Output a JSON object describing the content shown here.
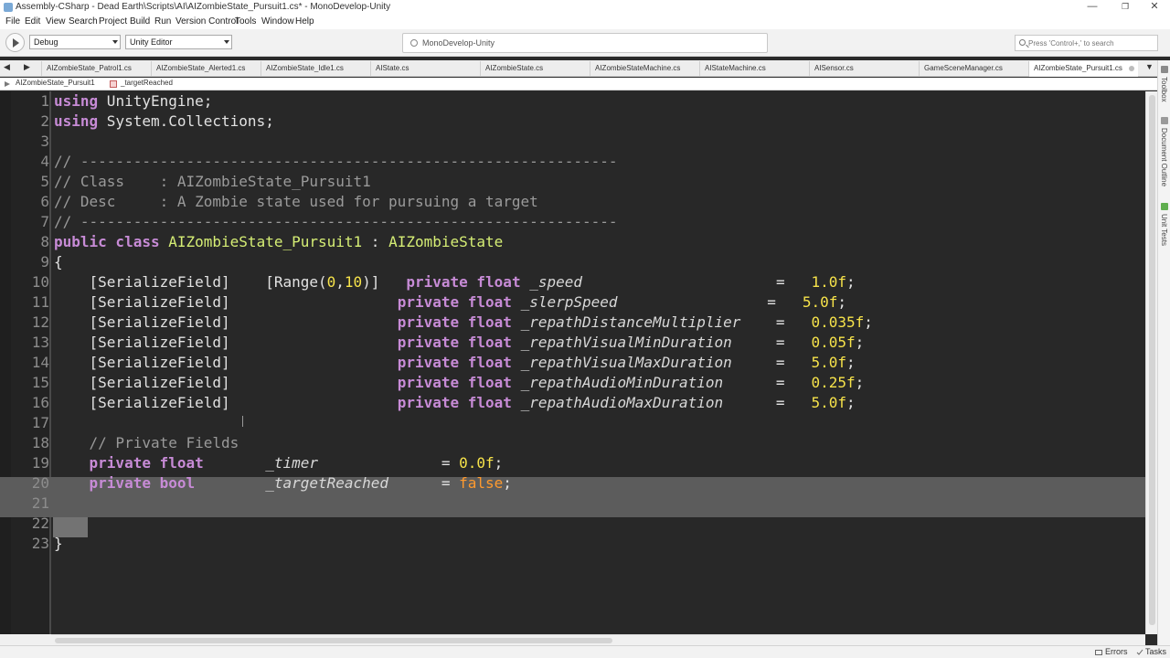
{
  "window": {
    "title": "Assembly-CSharp - Dead Earth\\Scripts\\AI\\AIZombieState_Pursuit1.cs* - MonoDevelop-Unity",
    "minimize": "—",
    "maximize": "❐",
    "close": "✕"
  },
  "menu": [
    "File",
    "Edit",
    "View",
    "Search",
    "Project",
    "Build",
    "Run",
    "Version Control",
    "Tools",
    "Window",
    "Help"
  ],
  "toolbar": {
    "configuration": "Debug",
    "target": "Unity Editor",
    "status": "MonoDevelop-Unity",
    "search_placeholder": "Press 'Control+,' to search"
  },
  "tabs": [
    {
      "label": "AIZombieState_Patrol1.cs"
    },
    {
      "label": "AIZombieState_Alerted1.cs"
    },
    {
      "label": "AIZombieState_Idle1.cs"
    },
    {
      "label": "AIState.cs"
    },
    {
      "label": "AIZombieState.cs"
    },
    {
      "label": "AIZombieStateMachine.cs"
    },
    {
      "label": "AIStateMachine.cs"
    },
    {
      "label": "AISensor.cs"
    },
    {
      "label": "GameSceneManager.cs"
    },
    {
      "label": "AIZombieState_Pursuit1.cs",
      "active": true
    }
  ],
  "breadcrumb": {
    "class_name": "AIZombieState_Pursuit1",
    "member": "_targetReached"
  },
  "editor": {
    "lines": [
      {
        "n": "1",
        "segs": [
          [
            "kw",
            "using"
          ],
          [
            "txt",
            " UnityEngine;"
          ]
        ]
      },
      {
        "n": "2",
        "segs": [
          [
            "kw",
            "using"
          ],
          [
            "txt",
            " System.Collections;"
          ]
        ]
      },
      {
        "n": "3",
        "segs": []
      },
      {
        "n": "4",
        "segs": [
          [
            "cm",
            "// -------------------------------------------------------------"
          ]
        ]
      },
      {
        "n": "5",
        "segs": [
          [
            "cm",
            "// Class    : AIZombieState_Pursuit1"
          ]
        ]
      },
      {
        "n": "6",
        "segs": [
          [
            "cm",
            "// Desc     : A Zombie state used for pursuing a target"
          ]
        ]
      },
      {
        "n": "7",
        "segs": [
          [
            "cm",
            "// -------------------------------------------------------------"
          ]
        ]
      },
      {
        "n": "8",
        "segs": [
          [
            "kw",
            "public class"
          ],
          [
            "txt",
            " "
          ],
          [
            "ty",
            "AIZombieState_Pursuit1"
          ],
          [
            "txt",
            " : "
          ],
          [
            "ty",
            "AIZombieState"
          ]
        ]
      },
      {
        "n": "9",
        "segs": [
          [
            "txt",
            "{"
          ]
        ]
      },
      {
        "n": "10",
        "segs": [
          [
            "txt",
            "    [SerializeField]    [Range("
          ],
          [
            "num",
            "0"
          ],
          [
            "txt",
            ","
          ],
          [
            "num",
            "10"
          ],
          [
            "txt",
            ")]   "
          ],
          [
            "kw",
            "private float"
          ],
          [
            "txt",
            " "
          ],
          [
            "fld",
            "_speed"
          ],
          [
            "txt",
            "                      =   "
          ],
          [
            "num",
            "1.0f"
          ],
          [
            "txt",
            ";"
          ]
        ]
      },
      {
        "n": "11",
        "segs": [
          [
            "txt",
            "    [SerializeField]                   "
          ],
          [
            "kw",
            "private float"
          ],
          [
            "txt",
            " "
          ],
          [
            "fld",
            "_slerpSpeed"
          ],
          [
            "txt",
            "                 =   "
          ],
          [
            "num",
            "5.0f"
          ],
          [
            "txt",
            ";"
          ]
        ]
      },
      {
        "n": "12",
        "segs": [
          [
            "txt",
            "    [SerializeField]                   "
          ],
          [
            "kw",
            "private float"
          ],
          [
            "txt",
            " "
          ],
          [
            "fld",
            "_repathDistanceMultiplier"
          ],
          [
            "txt",
            "    =   "
          ],
          [
            "num",
            "0.035f"
          ],
          [
            "txt",
            ";"
          ]
        ]
      },
      {
        "n": "13",
        "segs": [
          [
            "txt",
            "    [SerializeField]                   "
          ],
          [
            "kw",
            "private float"
          ],
          [
            "txt",
            " "
          ],
          [
            "fld",
            "_repathVisualMinDuration"
          ],
          [
            "txt",
            "     =   "
          ],
          [
            "num",
            "0.05f"
          ],
          [
            "txt",
            ";"
          ]
        ]
      },
      {
        "n": "14",
        "segs": [
          [
            "txt",
            "    [SerializeField]                   "
          ],
          [
            "kw",
            "private float"
          ],
          [
            "txt",
            " "
          ],
          [
            "fld",
            "_repathVisualMaxDuration"
          ],
          [
            "txt",
            "     =   "
          ],
          [
            "num",
            "5.0f"
          ],
          [
            "txt",
            ";"
          ]
        ]
      },
      {
        "n": "15",
        "segs": [
          [
            "txt",
            "    [SerializeField]                   "
          ],
          [
            "kw",
            "private float"
          ],
          [
            "txt",
            " "
          ],
          [
            "fld",
            "_repathAudioMinDuration"
          ],
          [
            "txt",
            "      =   "
          ],
          [
            "num",
            "0.25f"
          ],
          [
            "txt",
            ";"
          ]
        ]
      },
      {
        "n": "16",
        "segs": [
          [
            "txt",
            "    [SerializeField]                   "
          ],
          [
            "kw",
            "private float"
          ],
          [
            "txt",
            " "
          ],
          [
            "fld",
            "_repathAudioMaxDuration"
          ],
          [
            "txt",
            "      =   "
          ],
          [
            "num",
            "5.0f"
          ],
          [
            "txt",
            ";"
          ]
        ]
      },
      {
        "n": "17",
        "segs": []
      },
      {
        "n": "18",
        "segs": [
          [
            "txt",
            "    "
          ],
          [
            "cm",
            "// Private Fields"
          ]
        ]
      },
      {
        "n": "19",
        "segs": [
          [
            "txt",
            "    "
          ],
          [
            "kw",
            "private float"
          ],
          [
            "txt",
            "       "
          ],
          [
            "fld",
            "_timer"
          ],
          [
            "txt",
            "              = "
          ],
          [
            "num",
            "0.0f"
          ],
          [
            "txt",
            ";"
          ]
        ]
      },
      {
        "n": "20",
        "segs": [
          [
            "txt",
            "    "
          ],
          [
            "kw",
            "private bool"
          ],
          [
            "txt",
            "        "
          ],
          [
            "fld",
            "_targetReached"
          ],
          [
            "txt",
            "      = "
          ],
          [
            "kwconst",
            "false"
          ],
          [
            "txt",
            ";"
          ]
        ],
        "highlight": true
      },
      {
        "n": "21",
        "segs": [],
        "highlight": true
      },
      {
        "n": "22",
        "segs": []
      },
      {
        "n": "23",
        "segs": [
          [
            "txt",
            "}"
          ]
        ]
      }
    ]
  },
  "dock": {
    "toolbox": "Toolbox",
    "outline": "Document Outline",
    "unit_tests": "Unit Tests"
  },
  "statusbar": {
    "errors": "Errors",
    "tasks": "Tasks"
  },
  "colors": {
    "editor_bg": "#282828",
    "keyword": "#c78bd6",
    "type": "#d6ee75",
    "comment": "#9a9a9a",
    "number": "#f7e34a",
    "constant": "#ff9a2e"
  }
}
